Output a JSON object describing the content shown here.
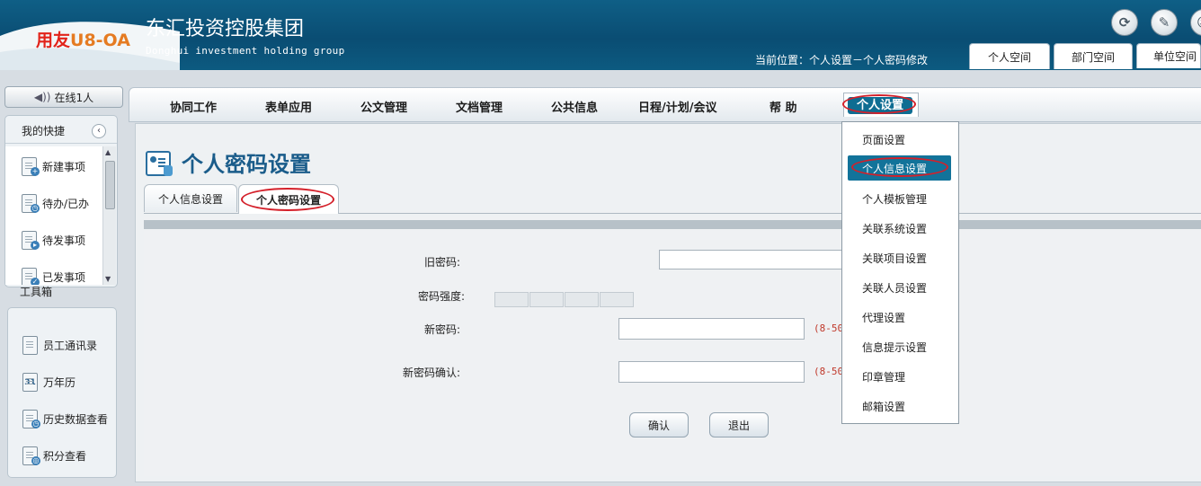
{
  "header": {
    "logo_part1": "用友",
    "logo_part2": "U8-OA",
    "company_cn": "东汇投资控股集团",
    "company_en": "Donghui investment holding group",
    "location": "当前位置：个人设置－个人密码修改",
    "icons": [
      "refresh-icon",
      "tools-icon",
      "user-icon"
    ],
    "space_tabs": [
      "个人空间",
      "部门空间",
      "单位空间"
    ]
  },
  "sidebar": {
    "online": "在线1人",
    "quick_title": "我的快捷",
    "quick_items": [
      "新建事项",
      "待办/已办",
      "待发事项",
      "已发事项"
    ],
    "toolbox_title": "工具箱",
    "toolbox_items": [
      "员工通讯录",
      "万年历",
      "历史数据查看",
      "积分查看"
    ],
    "calendar_day": "31"
  },
  "nav": {
    "items": [
      "协同工作",
      "表单应用",
      "公文管理",
      "文档管理",
      "公共信息",
      "日程/计划/会议",
      "帮 助"
    ],
    "active": "个人设置"
  },
  "dropdown": {
    "items": [
      "页面设置",
      "个人信息设置",
      "个人模板管理",
      "关联系统设置",
      "关联项目设置",
      "关联人员设置",
      "代理设置",
      "信息提示设置",
      "印章管理",
      "邮箱设置"
    ],
    "highlighted": "个人信息设置"
  },
  "page": {
    "title": "个人密码设置",
    "tabs": [
      "个人信息设置",
      "个人密码设置"
    ],
    "active_tab": "个人密码设置"
  },
  "form": {
    "old_password_label": "旧密码:",
    "strength_label": "密码强度:",
    "new_password_label": "新密码:",
    "confirm_label": "新密码确认:",
    "hint": "(8-50",
    "confirm_button": "确认",
    "exit_button": "退出"
  },
  "colors": {
    "header": "#0a4d73",
    "highlight": "#12739a",
    "annotation_ring": "#d4202a"
  }
}
